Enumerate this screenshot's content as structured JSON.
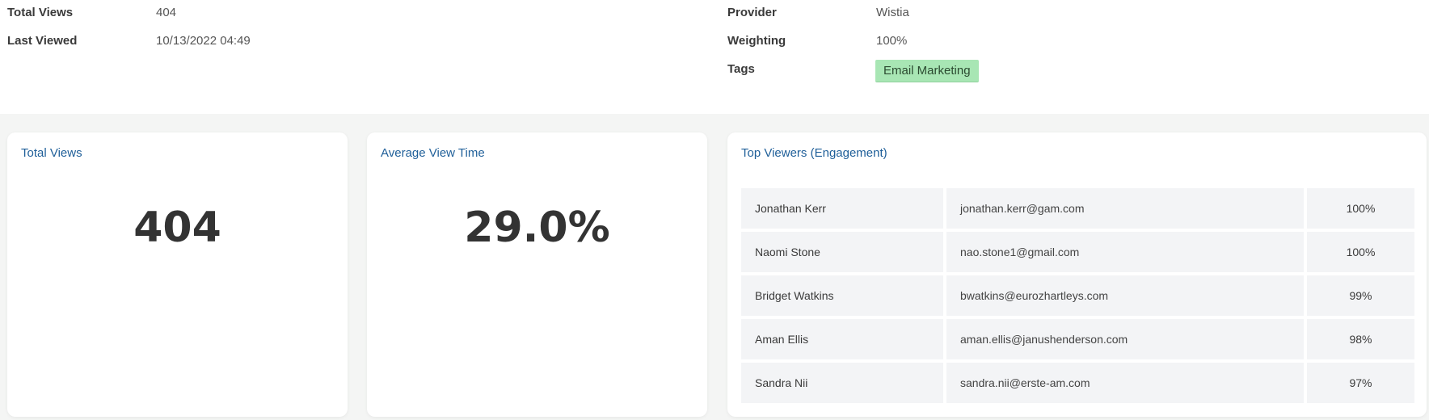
{
  "details": {
    "left": [
      {
        "label": "Total Views",
        "value": "404"
      },
      {
        "label": "Last Viewed",
        "value": "10/13/2022 04:49"
      }
    ],
    "right": [
      {
        "label": "Provider",
        "value": "Wistia"
      },
      {
        "label": "Weighting",
        "value": "100%"
      },
      {
        "label": "Tags",
        "value": ""
      }
    ],
    "tags": [
      "Email Marketing"
    ],
    "tag_color": "#a8e6b4"
  },
  "cards": {
    "total_views": {
      "title": "Total Views",
      "value": "404"
    },
    "avg_view_time": {
      "title": "Average View Time",
      "value": "29.0%"
    },
    "top_viewers": {
      "title": "Top Viewers (Engagement)",
      "rows": [
        {
          "name": "Jonathan Kerr",
          "email": "jonathan.kerr@gam.com",
          "score": "100%"
        },
        {
          "name": "Naomi Stone",
          "email": "nao.stone1@gmail.com",
          "score": "100%"
        },
        {
          "name": "Bridget Watkins",
          "email": "bwatkins@eurozhartleys.com",
          "score": "99%"
        },
        {
          "name": "Aman Ellis",
          "email": "aman.ellis@janushenderson.com",
          "score": "98%"
        },
        {
          "name": "Sandra Nii",
          "email": "sandra.nii@erste-am.com",
          "score": "97%"
        }
      ]
    }
  },
  "colors": {
    "accent": "#1f5f99",
    "page_bg": "#f4f5f4",
    "cell_bg": "#f3f4f6"
  }
}
